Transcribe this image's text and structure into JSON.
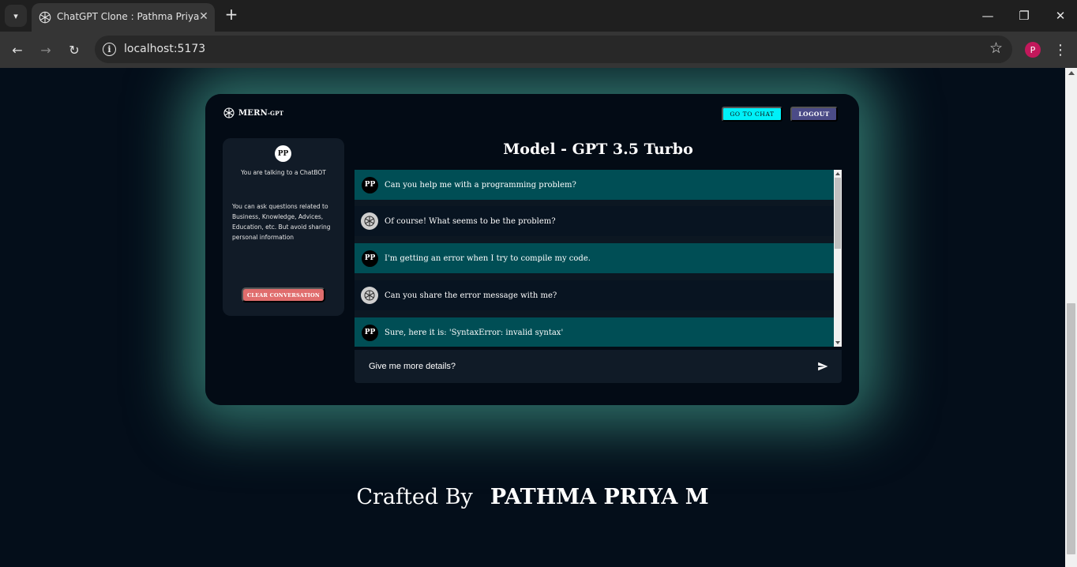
{
  "browser": {
    "tab_title": "ChatGPT Clone : Pathma Priya",
    "url": "localhost:5173",
    "profile_initial": "P"
  },
  "app": {
    "brand_main": "MERN",
    "brand_suffix": "-GPT",
    "go_to_chat_label": "GO TO CHAT",
    "logout_label": "LOGOUT",
    "colors": {
      "accent_cyan": "#00f0f8",
      "logout": "#4b4b87",
      "clear": "#e06d6d",
      "user_row": "#004e55"
    }
  },
  "sidebar": {
    "avatar_initials": "PP",
    "talking_text": "You are talking to a ChatBOT",
    "info_text": "You can ask questions related to Business, Knowledge, Advices, Education, etc. But avoid sharing personal information",
    "clear_label": "CLEAR CONVERSATION"
  },
  "chat": {
    "model_title": "Model - GPT 3.5 Turbo",
    "messages": [
      {
        "role": "user",
        "avatar": "PP",
        "text": "Can you help me with a programming problem?"
      },
      {
        "role": "assistant",
        "avatar": "openai-logo-icon",
        "text": "Of course! What seems to be the problem?"
      },
      {
        "role": "user",
        "avatar": "PP",
        "text": "I'm getting an error when I try to compile my code."
      },
      {
        "role": "assistant",
        "avatar": "openai-logo-icon",
        "text": "Can you share the error message with me?"
      },
      {
        "role": "user",
        "avatar": "PP",
        "text": "Sure, here it is: 'SyntaxError: invalid syntax'"
      }
    ],
    "input_value": "Give me more details?"
  },
  "footer": {
    "crafted_by": "Crafted By",
    "author": "PATHMA PRIYA M"
  }
}
